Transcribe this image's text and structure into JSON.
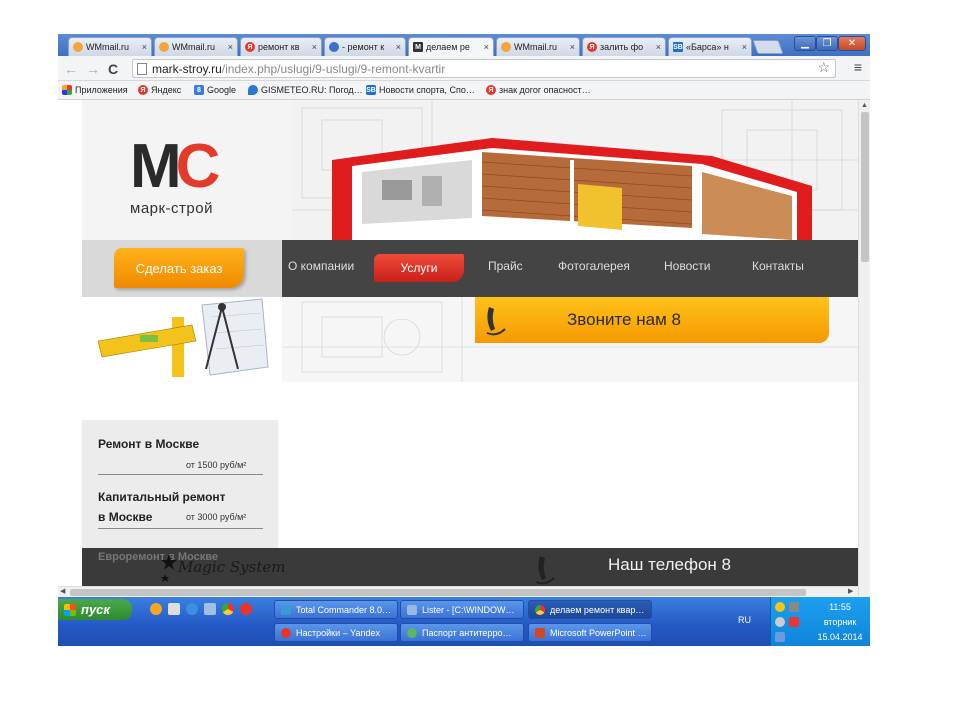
{
  "browser": {
    "tabs": [
      {
        "title": "WMmail.ru",
        "active": false,
        "icon": "wmmail-icon",
        "color": "#f3a43a"
      },
      {
        "title": "WMmail.ru",
        "active": false,
        "icon": "wmmail-icon",
        "color": "#f3a43a"
      },
      {
        "title": "ремонт кв",
        "active": false,
        "icon": "yandex-icon",
        "color": "#e8352a"
      },
      {
        "title": "- ремонт к",
        "active": false,
        "icon": "page-icon",
        "color": "#3a6fc7"
      },
      {
        "title": "делаем ре",
        "active": true,
        "icon": "mc-icon",
        "color": "#333333"
      },
      {
        "title": "WMmail.ru",
        "active": false,
        "icon": "wmmail-icon",
        "color": "#f3a43a"
      },
      {
        "title": "залить фо",
        "active": false,
        "icon": "yandex-icon",
        "color": "#e8352a"
      },
      {
        "title": "«Барса» н",
        "active": false,
        "icon": "sb-icon",
        "color": "#1f6fc9"
      }
    ],
    "tab_close": "×",
    "url_host": "mark-stroy.ru",
    "url_path": "/index.php/uslugi/9-uslugi/9-remont-kvartir",
    "bookmarks": [
      {
        "label": "Приложения",
        "icon": "apps-icon",
        "color": "#d44"
      },
      {
        "label": "Яндекс",
        "icon": "yandex-icon",
        "color": "#e8352a"
      },
      {
        "label": "Google",
        "icon": "google-icon",
        "color": "#3a7be0"
      },
      {
        "label": "GISMETEO.RU: Погод…",
        "icon": "gismeteo-icon",
        "color": "#2a78d0"
      },
      {
        "label": "Новости спорта, Спо…",
        "icon": "sb-icon",
        "color": "#1f6fc9"
      },
      {
        "label": "знак догог опасност…",
        "icon": "yandex-icon",
        "color": "#e8352a"
      }
    ]
  },
  "site": {
    "logo_letters": "MC",
    "logo_text": "марк-строй",
    "order_button": "Сделать заказ",
    "nav": [
      "О компании",
      "Услуги",
      "Прайс",
      "Фотогалерея",
      "Новости",
      "Контакты"
    ],
    "phone_banner": "Звоните нам 8",
    "services": [
      {
        "title": "Ремонт в Москве",
        "price": "от 1500 руб/м²"
      },
      {
        "title_line1": "Капитальный ремонт",
        "title_line2": "в Москве",
        "price": "от 3000 руб/м²"
      }
    ],
    "bottom_faded": "Евроремонт в Москве",
    "magic_text": "Magic System",
    "bottom_phone": "Наш телефон 8",
    "accent_orange": "#f59a00",
    "accent_red": "#d8261d"
  },
  "taskbar": {
    "start_label": "пуск",
    "buttons_row1": [
      {
        "label": "Total Commander 8.0…",
        "icon": "total-commander-icon"
      },
      {
        "label": "Lister - [C:\\WINDOW…",
        "icon": "lister-icon"
      },
      {
        "label": "делаем ремонт квар…",
        "icon": "chrome-icon",
        "active": true
      }
    ],
    "buttons_row2": [
      {
        "label": "Настройки – Yandex",
        "icon": "yandex-browser-icon"
      },
      {
        "label": "Паспорт антитерро…",
        "icon": "document-icon"
      },
      {
        "label": "Microsoft PowerPoint …",
        "icon": "powerpoint-icon"
      }
    ],
    "lang": "RU",
    "time": "11:55",
    "weekday": "вторник",
    "date": "15.04.2014"
  }
}
